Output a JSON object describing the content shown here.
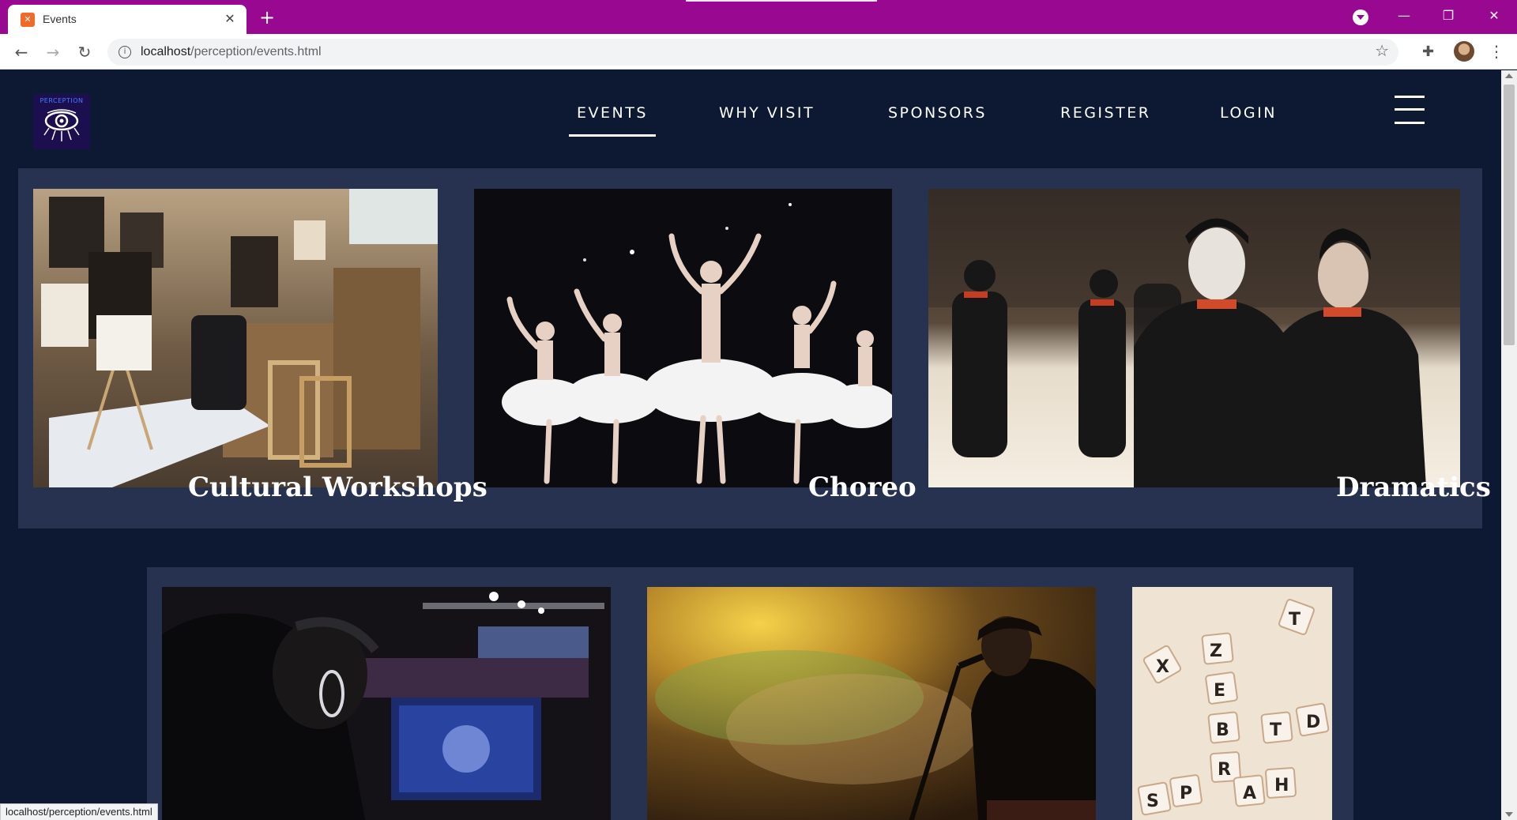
{
  "browser": {
    "tab_title": "Events",
    "url_host": "localhost",
    "url_path": "/perception/events.html",
    "status_url": "localhost/perception/events.html"
  },
  "site": {
    "logo_text": "PERCEPTION",
    "nav": [
      {
        "label": "EVENTS",
        "active": true
      },
      {
        "label": "WHY VISIT",
        "active": false
      },
      {
        "label": "SPONSORS",
        "active": false
      },
      {
        "label": "REGISTER",
        "active": false
      },
      {
        "label": "LOGIN",
        "active": false
      }
    ]
  },
  "events": [
    {
      "label": "Cultural Workshops",
      "image": "art-studio-photo"
    },
    {
      "label": "Choreo",
      "image": "ballet-dancers-photo"
    },
    {
      "label": "Dramatics",
      "image": "mime-actors-stage-photo"
    },
    {
      "label": "",
      "image": "esports-gamer-photo"
    },
    {
      "label": "",
      "image": "singer-smoke-stage-photo"
    },
    {
      "label": "",
      "image": "scrabble-tiles-photo"
    }
  ],
  "colors": {
    "titlebar": "#980890",
    "page_bg": "#0d1933",
    "card_bg": "#263250"
  }
}
